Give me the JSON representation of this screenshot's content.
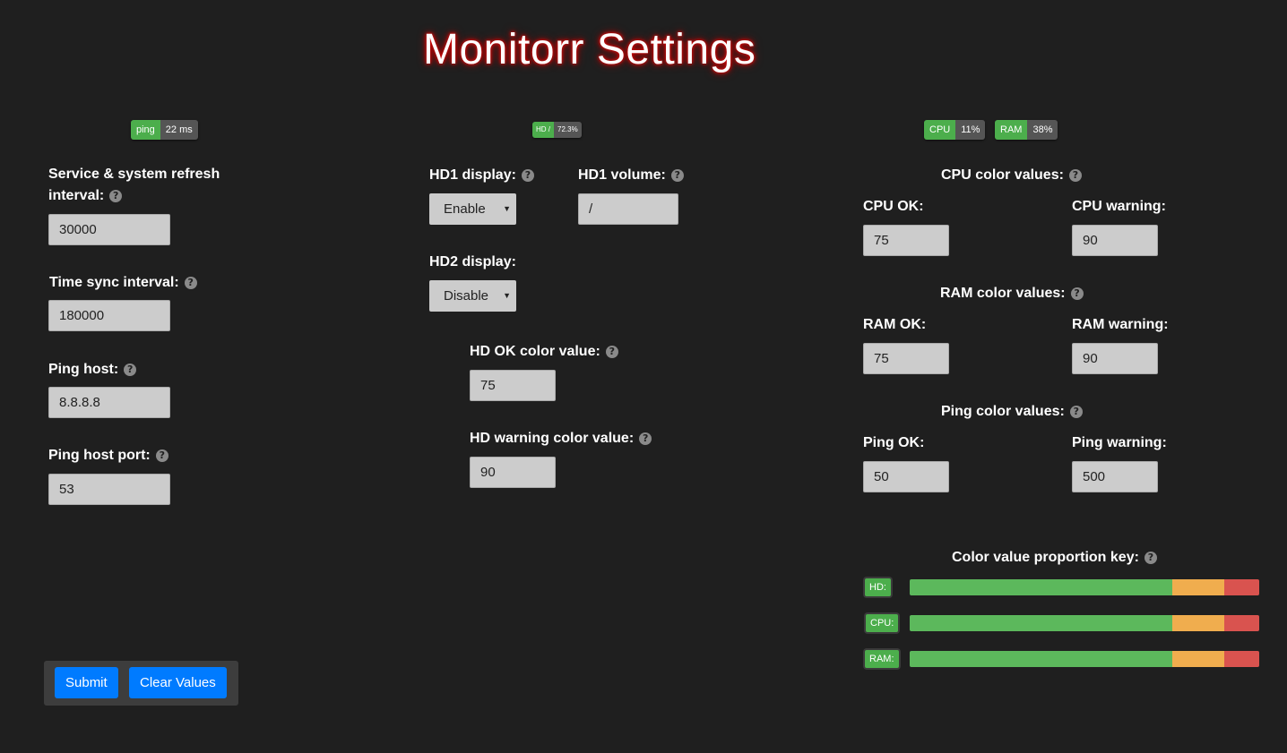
{
  "page": {
    "title": "Monitorr Settings"
  },
  "badges": {
    "ping": {
      "label": "ping",
      "value": "22 ms"
    },
    "hd": {
      "label": "HD /",
      "value": "72.3%"
    },
    "cpu": {
      "label": "CPU",
      "value": "11%"
    },
    "ram": {
      "label": "RAM",
      "value": "38%"
    },
    "color_ok": "#4cae4c",
    "color_value_bg": "#555555"
  },
  "left": {
    "refresh": {
      "label": "Service & system refresh interval:",
      "value": "30000"
    },
    "timesync": {
      "label": "Time sync interval:",
      "value": "180000"
    },
    "pinghost": {
      "label": "Ping host:",
      "value": "8.8.8.8"
    },
    "pingport": {
      "label": "Ping host port:",
      "value": "53"
    }
  },
  "middle": {
    "hd1_display": {
      "label": "HD1 display:",
      "value": "Enable"
    },
    "hd1_volume": {
      "label": "HD1 volume:",
      "value": "/"
    },
    "hd2_display": {
      "label": "HD2 display:",
      "value": "Disable"
    },
    "hd_ok": {
      "label": "HD OK color value:",
      "value": "75"
    },
    "hd_warning": {
      "label": "HD warning color value:",
      "value": "90"
    }
  },
  "right": {
    "cpu_group": "CPU color values:",
    "cpu_ok": {
      "label": "CPU OK:",
      "value": "75"
    },
    "cpu_warning": {
      "label": "CPU warning:",
      "value": "90"
    },
    "ram_group": "RAM color values:",
    "ram_ok": {
      "label": "RAM OK:",
      "value": "75"
    },
    "ram_warning": {
      "label": "RAM warning:",
      "value": "90"
    },
    "ping_group": "Ping color values:",
    "ping_ok": {
      "label": "Ping OK:",
      "value": "50"
    },
    "ping_warning": {
      "label": "Ping warning:",
      "value": "500"
    }
  },
  "key": {
    "title": "Color value proportion key:",
    "rows": [
      {
        "label": "HD:",
        "ok": 75,
        "warn": 90
      },
      {
        "label": "CPU:",
        "ok": 75,
        "warn": 90
      },
      {
        "label": "RAM:",
        "ok": 75,
        "warn": 90
      }
    ],
    "colors": {
      "ok": "#5cb85c",
      "warning": "#f0ad4e",
      "danger": "#d9534f"
    }
  },
  "buttons": {
    "submit": "Submit",
    "clear": "Clear Values"
  },
  "icons": {
    "help": "question-circle-icon",
    "dropdown": "caret-down-icon"
  }
}
